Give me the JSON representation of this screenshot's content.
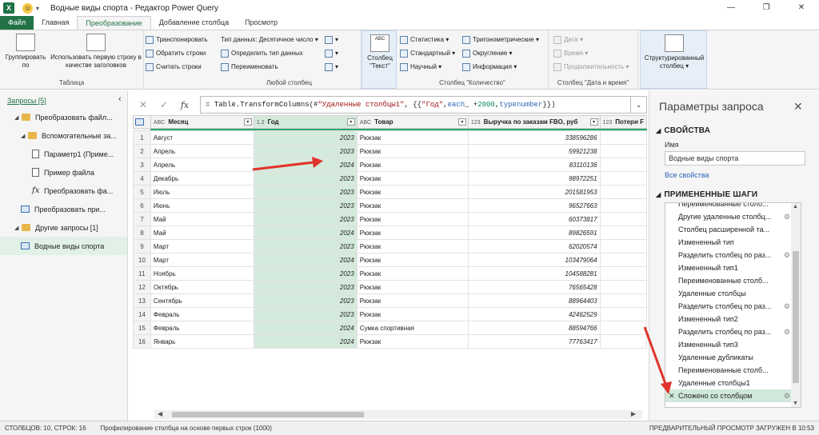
{
  "window": {
    "app_icon": "X",
    "title": "Водные виды спорта - Редактор Power Query",
    "controls": [
      "—",
      "❐",
      "✕"
    ]
  },
  "tabs": [
    "Файл",
    "Главная",
    "Преобразование",
    "Добавление столбца",
    "Просмотр"
  ],
  "ribbon": {
    "group_by": "Группировать по",
    "use_first_row": "Использовать первую строку в качестве заголовков",
    "table_group": "Таблица",
    "transpose": "Транспонировать",
    "reverse_rows": "Обратить строки",
    "count_rows": "Считать строки",
    "data_type": "Тип данных: Десятичное число",
    "detect_type": "Определить тип данных",
    "rename": "Переименовать",
    "any_column_group": "Любой столбец",
    "text_column": "Столбец \"Текст\"",
    "statistics": "Статистика",
    "standard": "Стандартный",
    "scientific": "Научный",
    "trigonometry": "Тригонометрические",
    "rounding": "Округление",
    "information": "Информация",
    "number_group": "Столбец \"Количество\"",
    "date": "Дата",
    "time": "Время",
    "duration": "Продолжительность",
    "datetime_group": "Столбец \"Дата и время\"",
    "structured_column": "Структурированный столбец"
  },
  "queries_pane": {
    "title": "Запросы [5]",
    "items": [
      {
        "label": "Преобразовать файл...",
        "type": "folder",
        "level": 1
      },
      {
        "label": "Вспомогательные за...",
        "type": "folder",
        "level": 2
      },
      {
        "label": "Параметр1 (Приме...",
        "type": "file",
        "level": 3
      },
      {
        "label": "Пример файла",
        "type": "file",
        "level": 3
      },
      {
        "label": "Преобразовать фа...",
        "type": "fx",
        "level": 3
      },
      {
        "label": "Преобразовать при...",
        "type": "table",
        "level": 2
      },
      {
        "label": "Другие запросы [1]",
        "type": "folder",
        "level": 1
      },
      {
        "label": "Водные виды спорта",
        "type": "table",
        "level": 2
      }
    ]
  },
  "formula": {
    "cancel": "✕",
    "ok": "✓",
    "fx": "fx",
    "expand": "⌄"
  },
  "grid": {
    "columns": [
      {
        "type": "ABC",
        "name": "Месяц"
      },
      {
        "type": "1.2",
        "name": "Год"
      },
      {
        "type": "ABC",
        "name": "Товар"
      },
      {
        "type": "123",
        "name": "Выручка по заказам FBO, руб"
      },
      {
        "type": "123",
        "name": "Потери F"
      }
    ],
    "rows": [
      [
        "1",
        "Август",
        "2023",
        "Рюкзак",
        "338596286"
      ],
      [
        "2",
        "Апрель",
        "2023",
        "Рюкзак",
        "59921238"
      ],
      [
        "3",
        "Апрель",
        "2024",
        "Рюкзак",
        "83110136"
      ],
      [
        "4",
        "Декабрь",
        "2023",
        "Рюкзак",
        "98972251"
      ],
      [
        "5",
        "Июль",
        "2023",
        "Рюкзак",
        "201581953"
      ],
      [
        "6",
        "Июнь",
        "2023",
        "Рюкзак",
        "96527663"
      ],
      [
        "7",
        "Май",
        "2023",
        "Рюкзак",
        "60373817"
      ],
      [
        "8",
        "Май",
        "2024",
        "Рюкзак",
        "89826591"
      ],
      [
        "9",
        "Март",
        "2023",
        "Рюкзак",
        "62020574"
      ],
      [
        "10",
        "Март",
        "2024",
        "Рюкзак",
        "103479064"
      ],
      [
        "11",
        "Ноябрь",
        "2023",
        "Рюкзак",
        "104588281"
      ],
      [
        "12",
        "Октябрь",
        "2023",
        "Рюкзак",
        "76565428"
      ],
      [
        "13",
        "Сентябрь",
        "2023",
        "Рюкзак",
        "88964403"
      ],
      [
        "14",
        "Февраль",
        "2023",
        "Рюкзак",
        "42462529"
      ],
      [
        "15",
        "Февраль",
        "2024",
        "Сумка спортивная",
        "88594766"
      ],
      [
        "16",
        "Январь",
        "2024",
        "Рюкзак",
        "77763417"
      ]
    ]
  },
  "settings": {
    "title": "Параметры запроса",
    "properties": "СВОЙСТВА",
    "name_label": "Имя",
    "name_value": "Водные виды спорта",
    "all_properties": "Все свойства",
    "applied_steps": "ПРИМЕНЕННЫЕ ШАГИ",
    "steps": [
      {
        "label": "Переименованные столб...",
        "gear": false
      },
      {
        "label": "Другие удаленные столбц...",
        "gear": true
      },
      {
        "label": "Столбец расширенной та...",
        "gear": false
      },
      {
        "label": "Измененный тип",
        "gear": false
      },
      {
        "label": "Разделить столбец по раз...",
        "gear": true
      },
      {
        "label": "Измененный тип1",
        "gear": false
      },
      {
        "label": "Переименованные столб...",
        "gear": false
      },
      {
        "label": "Удаленные столбцы",
        "gear": false
      },
      {
        "label": "Разделить столбец по раз...",
        "gear": true
      },
      {
        "label": "Измененный тип2",
        "gear": false
      },
      {
        "label": "Разделить столбец по раз...",
        "gear": true
      },
      {
        "label": "Измененный тип3",
        "gear": false
      },
      {
        "label": "Удаленные дубликаты",
        "gear": false
      },
      {
        "label": "Переименованные столб...",
        "gear": false
      },
      {
        "label": "Удаленные столбцы1",
        "gear": false
      },
      {
        "label": "Сложено со столбцом",
        "gear": true,
        "active": true
      }
    ]
  },
  "status": {
    "left": "СТОЛБЦОВ: 10, СТРОК: 16",
    "profiling": "Профилирование столбца на основе первых строк (1000)",
    "right": "ПРЕДВАРИТЕЛЬНЫЙ ПРОСМОТР ЗАГРУЖЕН В 10:53"
  },
  "colors": {
    "accent": "#217346",
    "selected_column": "#d4eadc",
    "arrow": "#e0332b"
  }
}
